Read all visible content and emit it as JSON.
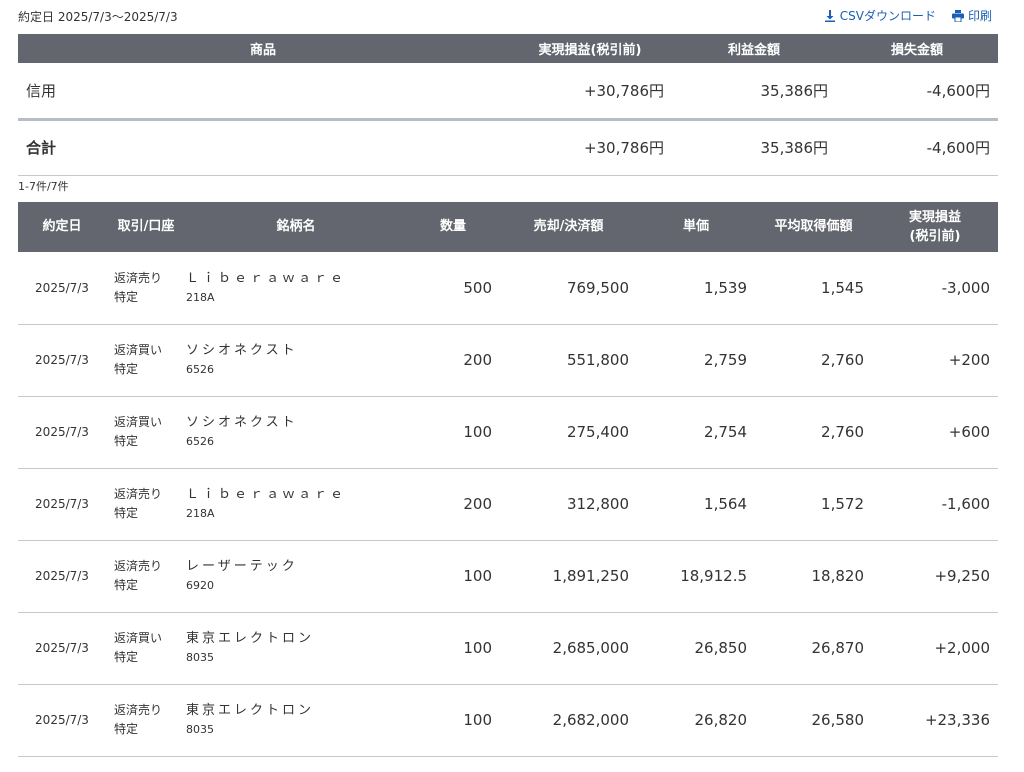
{
  "header": {
    "date_range": "約定日 2025/7/3〜2025/7/3",
    "csv_label": "CSVダウンロード",
    "print_label": "印刷"
  },
  "summary": {
    "columns": [
      "商品",
      "実現損益(税引前)",
      "利益金額",
      "損失金額"
    ],
    "rows": [
      {
        "label": "信用",
        "pnl": "+30,786円",
        "profit": "35,386円",
        "loss": "-4,600円"
      },
      {
        "label": "合計",
        "pnl": "+30,786円",
        "profit": "35,386円",
        "loss": "-4,600円"
      }
    ]
  },
  "count_text": "1-7件/7件",
  "detail": {
    "columns": [
      "約定日",
      "取引/口座",
      "銘柄名",
      "数量",
      "売却/決済額",
      "単価",
      "平均取得価額",
      "実現損益\n(税引前)"
    ],
    "rows": [
      {
        "date": "2025/7/3",
        "trade": "返済売り",
        "account": "特定",
        "name": "Ｌｉｂｅｒａｗａｒｅ",
        "code": "218A",
        "qty": "500",
        "amount": "769,500",
        "price": "1,539",
        "avg": "1,545",
        "pnl": "-3,000",
        "sign": "neg"
      },
      {
        "date": "2025/7/3",
        "trade": "返済買い",
        "account": "特定",
        "name": "ソシオネクスト",
        "code": "6526",
        "qty": "200",
        "amount": "551,800",
        "price": "2,759",
        "avg": "2,760",
        "pnl": "+200",
        "sign": "pos"
      },
      {
        "date": "2025/7/3",
        "trade": "返済買い",
        "account": "特定",
        "name": "ソシオネクスト",
        "code": "6526",
        "qty": "100",
        "amount": "275,400",
        "price": "2,754",
        "avg": "2,760",
        "pnl": "+600",
        "sign": "pos"
      },
      {
        "date": "2025/7/3",
        "trade": "返済売り",
        "account": "特定",
        "name": "Ｌｉｂｅｒａｗａｒｅ",
        "code": "218A",
        "qty": "200",
        "amount": "312,800",
        "price": "1,564",
        "avg": "1,572",
        "pnl": "-1,600",
        "sign": "neg"
      },
      {
        "date": "2025/7/3",
        "trade": "返済売り",
        "account": "特定",
        "name": "レーザーテック",
        "code": "6920",
        "qty": "100",
        "amount": "1,891,250",
        "price": "18,912.5",
        "avg": "18,820",
        "pnl": "+9,250",
        "sign": "pos"
      },
      {
        "date": "2025/7/3",
        "trade": "返済買い",
        "account": "特定",
        "name": "東京エレクトロン",
        "code": "8035",
        "qty": "100",
        "amount": "2,685,000",
        "price": "26,850",
        "avg": "26,870",
        "pnl": "+2,000",
        "sign": "pos"
      },
      {
        "date": "2025/7/3",
        "trade": "返済売り",
        "account": "特定",
        "name": "東京エレクトロン",
        "code": "8035",
        "qty": "100",
        "amount": "2,682,000",
        "price": "26,820",
        "avg": "26,580",
        "pnl": "+23,336",
        "sign": "pos"
      }
    ]
  },
  "colors": {
    "header_bg": "#63666e",
    "positive": "#d6195d",
    "negative": "#1e8c8c",
    "link": "#1a5fb4"
  }
}
